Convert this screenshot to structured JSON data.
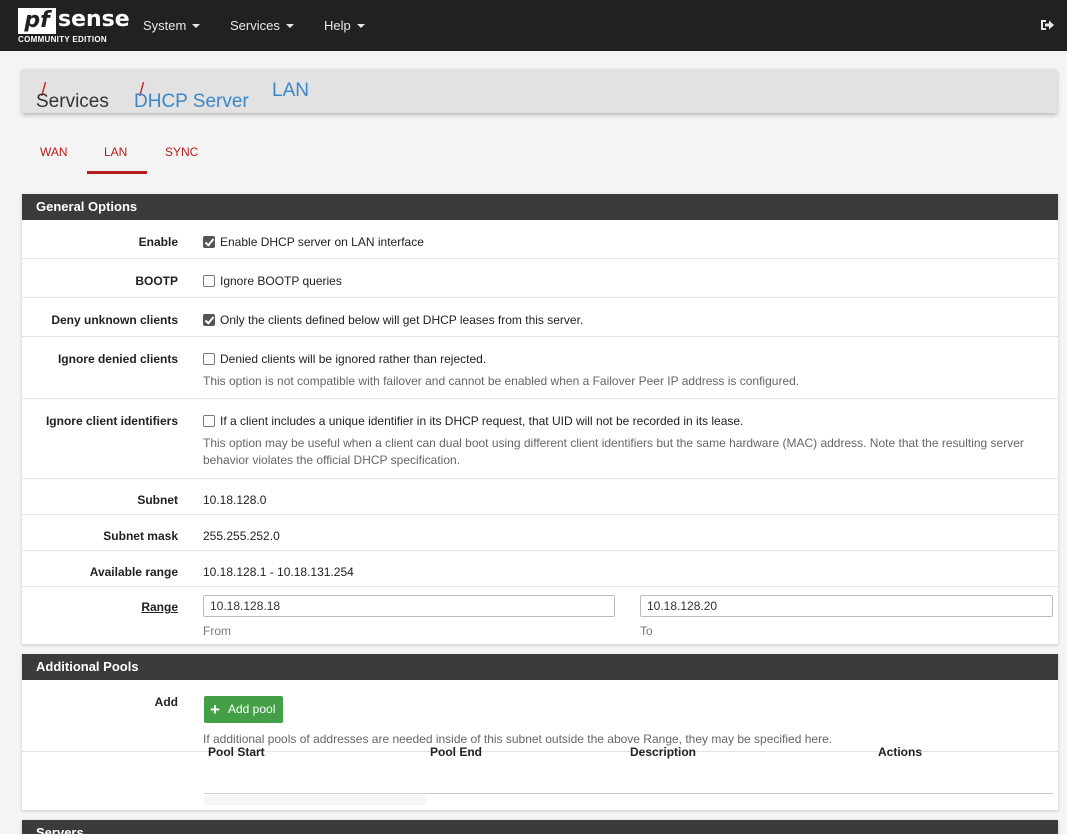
{
  "navbar": {
    "logo_mark": "pf",
    "logo_text": "sense",
    "logo_sub": "COMMUNITY EDITION",
    "menus": [
      "System",
      "Services",
      "Help"
    ]
  },
  "breadcrumb": {
    "part1": "Services",
    "part2": "DHCP Server",
    "part3": "LAN",
    "separator": "/"
  },
  "tabs": [
    "WAN",
    "LAN",
    "SYNC"
  ],
  "active_tab": "LAN",
  "general": {
    "heading": "General Options",
    "enable": {
      "label": "Enable",
      "text": "Enable DHCP server on LAN interface",
      "checked": true
    },
    "bootp": {
      "label": "BOOTP",
      "text": "Ignore BOOTP queries",
      "checked": false
    },
    "deny": {
      "label": "Deny unknown clients",
      "text": "Only the clients defined below will get DHCP leases from this server.",
      "checked": true
    },
    "ignore_denied": {
      "label": "Ignore denied clients",
      "text": "Denied clients will be ignored rather than rejected.",
      "help": "This option is not compatible with failover and cannot be enabled when a Failover Peer IP address is configured.",
      "checked": false
    },
    "ignore_uid": {
      "label": "Ignore client identifiers",
      "text": "If a client includes a unique identifier in its DHCP request, that UID will not be recorded in its lease.",
      "help": "This option may be useful when a client can dual boot using different client identifiers but the same hardware (MAC) address. Note that the resulting server behavior violates the official DHCP specification.",
      "checked": false
    },
    "subnet": {
      "label": "Subnet",
      "value": "10.18.128.0"
    },
    "mask": {
      "label": "Subnet mask",
      "value": "255.255.252.0"
    },
    "available": {
      "label": "Available range",
      "value": "10.18.128.1 - 10.18.131.254"
    },
    "range": {
      "label": "Range",
      "from": "10.18.128.18",
      "from_hint": "From",
      "to": "10.18.128.20",
      "to_hint": "To"
    }
  },
  "pools": {
    "heading": "Additional Pools",
    "add_label": "Add",
    "button": "Add pool",
    "help": "If additional pools of addresses are needed inside of this subnet outside the above Range, they may be specified here.",
    "columns": [
      "Pool Start",
      "Pool End",
      "Description",
      "Actions"
    ]
  },
  "servers": {
    "heading": "Servers"
  },
  "colors": {
    "navbar": "#212121",
    "accent": "#b71c1c",
    "link": "#3a87c9",
    "success": "#43a047",
    "panel_heading": "#3b3b3b"
  },
  "icons": [
    "logout-icon",
    "checkbox-icon",
    "plus-icon"
  ]
}
